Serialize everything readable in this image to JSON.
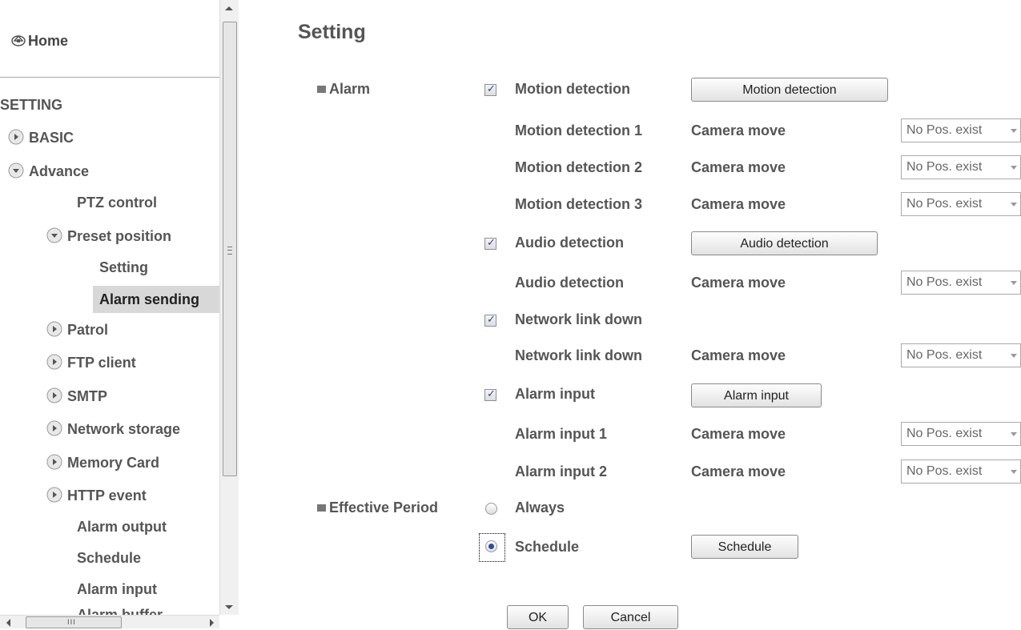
{
  "sidebar": {
    "home_label": "Home",
    "section_label": "SETTING",
    "items": {
      "basic": "BASIC",
      "advance": "Advance",
      "ptz_control": "PTZ control",
      "preset_position": "Preset position",
      "setting": "Setting",
      "alarm_sending": "Alarm sending",
      "patrol": "Patrol",
      "ftp_client": "FTP client",
      "smtp": "SMTP",
      "network_storage": "Network storage",
      "memory_card": "Memory Card",
      "http_event": "HTTP event",
      "alarm_output": "Alarm output",
      "schedule": "Schedule",
      "alarm_input": "Alarm input",
      "alarm_buffer": "Alarm buffer"
    },
    "hscroll_grip": "III"
  },
  "main": {
    "title": "Setting",
    "alarm_label": "Alarm",
    "effective_period_label": "Effective Period",
    "motion_detection": {
      "label": "Motion detection",
      "checked": true,
      "button": "Motion detection",
      "rows": [
        {
          "name": "Motion detection 1",
          "action": "Camera move",
          "select": "No Pos. exist"
        },
        {
          "name": "Motion detection 2",
          "action": "Camera move",
          "select": "No Pos. exist"
        },
        {
          "name": "Motion detection 3",
          "action": "Camera move",
          "select": "No Pos. exist"
        }
      ]
    },
    "audio_detection": {
      "label": "Audio detection",
      "checked": true,
      "button": "Audio detection",
      "row": {
        "name": "Audio detection",
        "action": "Camera move",
        "select": "No Pos. exist"
      }
    },
    "network_link_down": {
      "label": "Network link down",
      "checked": true,
      "row": {
        "name": "Network link down",
        "action": "Camera move",
        "select": "No Pos. exist"
      }
    },
    "alarm_input": {
      "label": "Alarm input",
      "checked": true,
      "button": "Alarm input",
      "rows": [
        {
          "name": "Alarm input 1",
          "action": "Camera move",
          "select": "No Pos. exist"
        },
        {
          "name": "Alarm input 2",
          "action": "Camera move",
          "select": "No Pos. exist"
        }
      ]
    },
    "period": {
      "always_label": "Always",
      "schedule_label": "Schedule",
      "schedule_button": "Schedule",
      "selected": "Schedule"
    },
    "ok_button": "OK",
    "cancel_button": "Cancel"
  }
}
